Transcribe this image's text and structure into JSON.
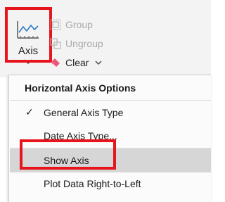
{
  "ribbon": {
    "axis_label": "Axis",
    "group_label": "Group",
    "ungroup_label": "Ungroup",
    "clear_label": "Clear",
    "icons": {
      "axis": "line-chart-axis-icon",
      "group": "group-icon",
      "ungroup": "ungroup-icon",
      "clear": "eraser-icon"
    }
  },
  "menu": {
    "header": "Horizontal Axis Options",
    "items": [
      {
        "label": "General Axis Type",
        "checked": true,
        "highlighted": false
      },
      {
        "label": "Date Axis Type...",
        "checked": false,
        "highlighted": false
      },
      {
        "label": "Show Axis",
        "checked": false,
        "highlighted": true
      },
      {
        "label": "Plot Data Right-to-Left",
        "checked": false,
        "highlighted": false
      }
    ],
    "check_glyph": "✓"
  },
  "colors": {
    "highlight_box": "#e8141c",
    "ribbon_bg": "#f3f3f3",
    "menu_bg": "#fbfbfb",
    "selected_bg": "#d6d6d6",
    "accent_blue": "#2b78c5",
    "eraser_pink": "#e8587a"
  }
}
